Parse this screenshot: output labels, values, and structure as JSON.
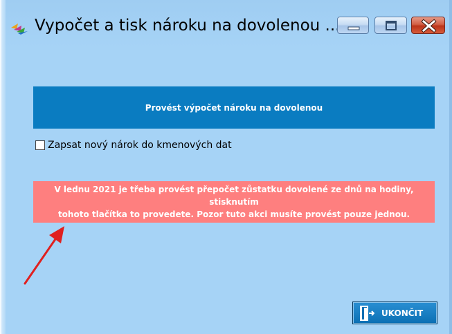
{
  "window": {
    "title": "Vypočet a tisk nároku na dovolenou ...",
    "icon": "app-leaves-icon",
    "controls": [
      "minimize-icon",
      "maximize-icon",
      "close-icon"
    ]
  },
  "main": {
    "action_button_label": "Provést výpočet nároku na dovolenou",
    "checkbox_label": "Zapsat nový nárok do kmenových dat",
    "checkbox_checked": false,
    "warning_line1": "V lednu 2021 je třeba provést přepočet zůstatku dovolené ze dnů na hodiny, stisknutím",
    "warning_line2": "tohoto tlačítka to provedete. Pozor tuto akci musíte provést pouze jednou."
  },
  "footer": {
    "exit_button_label": "UKONČIT",
    "exit_icon": "exit-door-icon"
  },
  "colors": {
    "background": "#a6d3f6",
    "action_button": "#0a7cc1",
    "warning_box": "#fe7f7f",
    "arrow": "#e0201f"
  }
}
